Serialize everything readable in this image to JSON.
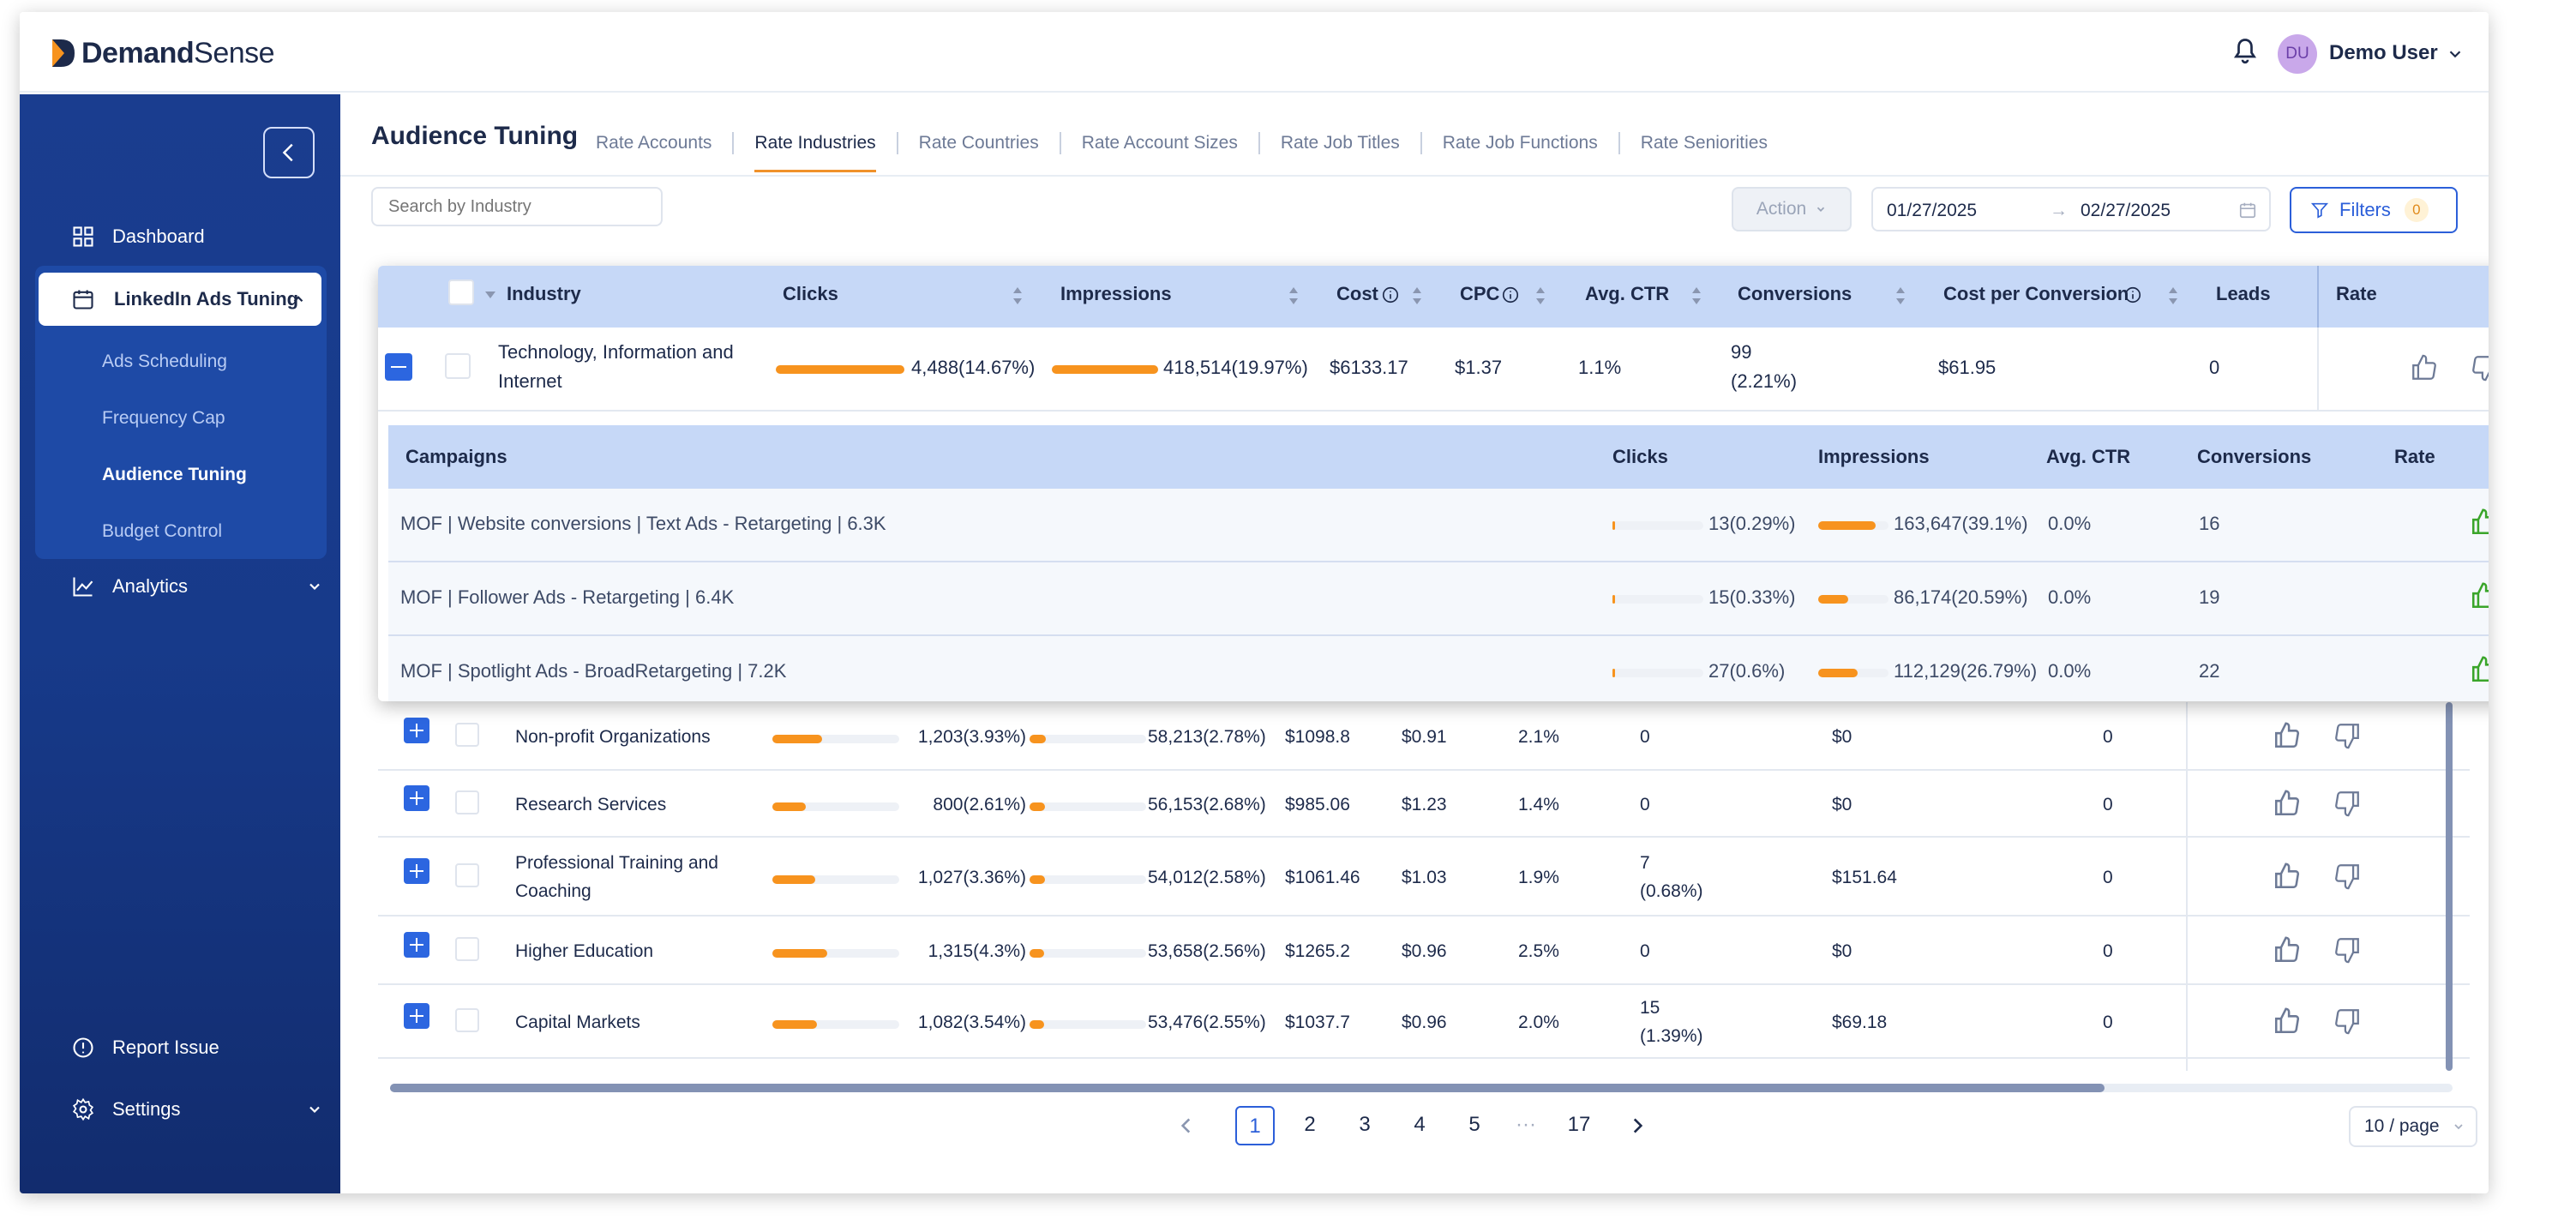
{
  "brand": {
    "name_bold": "Demand",
    "name_light": "Sense"
  },
  "user": {
    "initials": "DU",
    "name": "Demo User"
  },
  "sidebar": {
    "dashboard": "Dashboard",
    "linkedin": "LinkedIn Ads Tuning",
    "sub_items": [
      "Ads Scheduling",
      "Frequency Cap",
      "Audience Tuning",
      "Budget Control"
    ],
    "analytics": "Analytics",
    "report_issue": "Report Issue",
    "settings": "Settings"
  },
  "page": {
    "title": "Audience Tuning",
    "tabs": [
      "Rate Accounts",
      "Rate Industries",
      "Rate Countries",
      "Rate Account Sizes",
      "Rate Job Titles",
      "Rate Job Functions",
      "Rate Seniorities"
    ],
    "active_tab": "Rate Industries"
  },
  "toolbar": {
    "search_placeholder": "Search by Industry",
    "action_label": "Action",
    "date_start": "01/27/2025",
    "date_end": "02/27/2025",
    "date_arrow": "→",
    "filters_label": "Filters",
    "filters_count": "0"
  },
  "columns": {
    "industry": "Industry",
    "clicks": "Clicks",
    "impressions": "Impressions",
    "cost": "Cost",
    "cpc": "CPC",
    "avg_ctr": "Avg. CTR",
    "conversions": "Conversions",
    "cost_per_conversion": "Cost per Conversion",
    "leads": "Leads",
    "rate": "Rate"
  },
  "expanded_row": {
    "industry_line1": "Technology, Information and",
    "industry_line2": "Internet",
    "clicks": "4,488(14.67%)",
    "clicks_pct": 0.1467,
    "impressions": "418,514(19.97%)",
    "impressions_pct": 0.1997,
    "cost": "$6133.17",
    "cpc": "$1.37",
    "avg_ctr": "1.1%",
    "conversions_line1": "99",
    "conversions_line2": "(2.21%)",
    "cost_per_conversion": "$61.95",
    "leads": "0"
  },
  "campaign_columns": {
    "campaigns": "Campaigns",
    "clicks": "Clicks",
    "impressions": "Impressions",
    "avg_ctr": "Avg. CTR",
    "conversions": "Conversions",
    "rate": "Rate"
  },
  "campaigns": [
    {
      "name": "MOF | Website conversions | Text Ads - Retargeting | 6.3K",
      "clicks": "13(0.29%)",
      "clicks_pct": 0.0029,
      "impressions": "163,647(39.1%)",
      "impressions_pct": 0.391,
      "avg_ctr": "0.0%",
      "conversions": "16"
    },
    {
      "name": "MOF | Follower Ads - Retargeting | 6.4K",
      "clicks": "15(0.33%)",
      "clicks_pct": 0.0033,
      "impressions": "86,174(20.59%)",
      "impressions_pct": 0.2059,
      "avg_ctr": "0.0%",
      "conversions": "19"
    },
    {
      "name": "MOF | Spotlight Ads - BroadRetargeting | 7.2K",
      "clicks": "27(0.6%)",
      "clicks_pct": 0.006,
      "impressions": "112,129(26.79%)",
      "impressions_pct": 0.2679,
      "avg_ctr": "0.0%",
      "conversions": "22"
    }
  ],
  "rows": [
    {
      "industry_line1": "Non-profit Organizations",
      "industry_line2": "",
      "clicks": "1,203(3.93%)",
      "clicks_pct": 0.0393,
      "impressions": "58,213(2.78%)",
      "impressions_pct": 0.0278,
      "cost": "$1098.8",
      "cpc": "$0.91",
      "avg_ctr": "2.1%",
      "conversions_line1": "0",
      "conversions_line2": "",
      "cost_per_conversion": "$0",
      "leads": "0"
    },
    {
      "industry_line1": "Research Services",
      "industry_line2": "",
      "clicks": "800(2.61%)",
      "clicks_pct": 0.0261,
      "impressions": "56,153(2.68%)",
      "impressions_pct": 0.0268,
      "cost": "$985.06",
      "cpc": "$1.23",
      "avg_ctr": "1.4%",
      "conversions_line1": "0",
      "conversions_line2": "",
      "cost_per_conversion": "$0",
      "leads": "0"
    },
    {
      "industry_line1": "Professional Training and",
      "industry_line2": "Coaching",
      "clicks": "1,027(3.36%)",
      "clicks_pct": 0.0336,
      "impressions": "54,012(2.58%)",
      "impressions_pct": 0.0258,
      "cost": "$1061.46",
      "cpc": "$1.03",
      "avg_ctr": "1.9%",
      "conversions_line1": "7",
      "conversions_line2": "(0.68%)",
      "cost_per_conversion": "$151.64",
      "leads": "0"
    },
    {
      "industry_line1": "Higher Education",
      "industry_line2": "",
      "clicks": "1,315(4.3%)",
      "clicks_pct": 0.043,
      "impressions": "53,658(2.56%)",
      "impressions_pct": 0.0256,
      "cost": "$1265.2",
      "cpc": "$0.96",
      "avg_ctr": "2.5%",
      "conversions_line1": "0",
      "conversions_line2": "",
      "cost_per_conversion": "$0",
      "leads": "0"
    },
    {
      "industry_line1": "Capital Markets",
      "industry_line2": "",
      "clicks": "1,082(3.54%)",
      "clicks_pct": 0.0354,
      "impressions": "53,476(2.55%)",
      "impressions_pct": 0.0255,
      "cost": "$1037.7",
      "cpc": "$0.96",
      "avg_ctr": "2.0%",
      "conversions_line1": "15",
      "conversions_line2": "(1.39%)",
      "cost_per_conversion": "$69.18",
      "leads": "0"
    }
  ],
  "pagination": {
    "pages": [
      "1",
      "2",
      "3",
      "4",
      "5"
    ],
    "ellipsis": "···",
    "last": "17",
    "current": "1",
    "page_size": "10 / page"
  },
  "colors": {
    "accent": "#2c5fd9",
    "bar": "#f7931e",
    "sidebar": "#1a3d8f",
    "like_active": "#3aa52a"
  },
  "icons": [
    "bell-icon",
    "chevron-down-icon",
    "collapse-left-icon",
    "grid-icon",
    "calendar-icon",
    "chart-icon",
    "alert-circle-icon",
    "gear-icon",
    "filter-icon",
    "thumbs-up-icon",
    "thumbs-down-icon",
    "info-icon",
    "sort-icon"
  ]
}
